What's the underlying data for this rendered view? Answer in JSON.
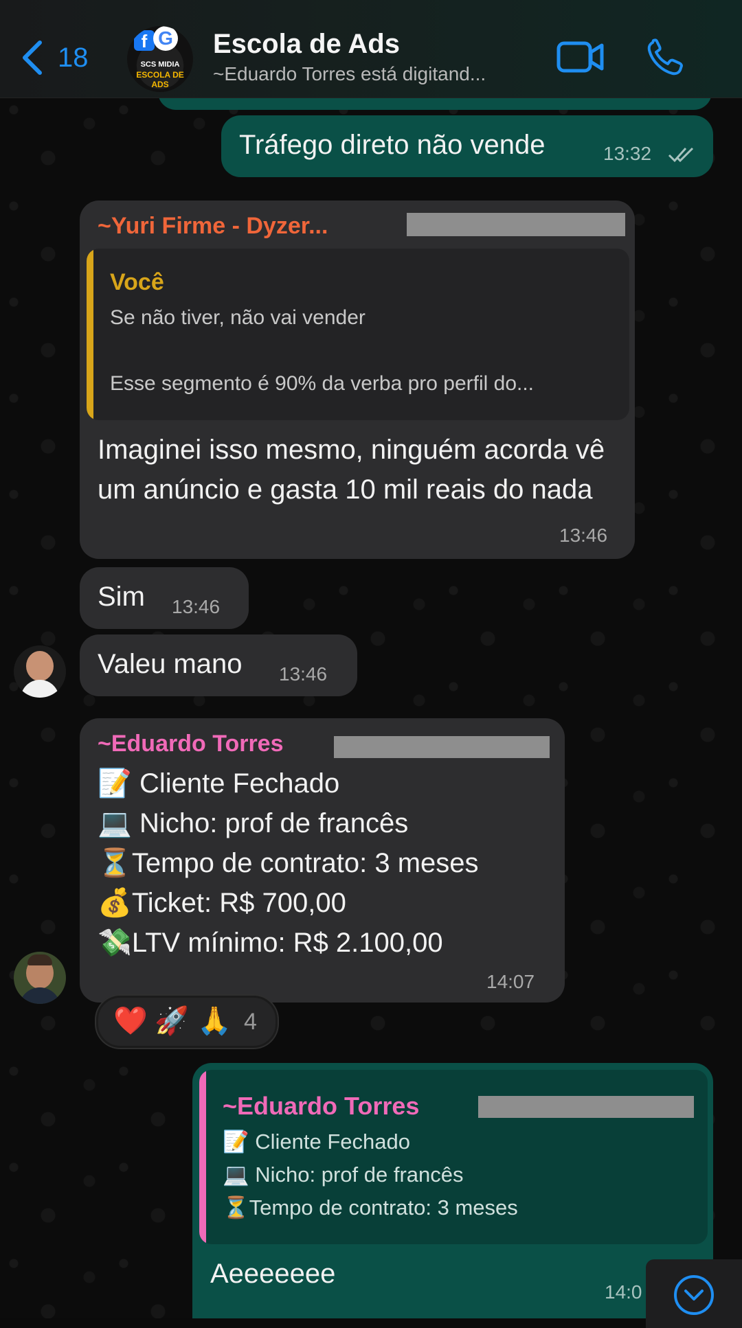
{
  "header": {
    "back_count": "18",
    "title": "Escola de Ads",
    "subtitle": "~Eduardo Torres está digitand...",
    "avatar_brand_line1": "SCS MIDIA",
    "avatar_brand_line2": "ESCOLA DE ADS",
    "icons": [
      "back-chevron-icon",
      "video-call-icon",
      "phone-call-icon"
    ]
  },
  "messages": {
    "m1": {
      "text": "Tráfego direto não vende",
      "time": "13:32"
    },
    "m2": {
      "sender": "~Yuri Firme - Dyzer...",
      "quote_author": "Você",
      "quote_line1": "Se não tiver, não vai vender",
      "quote_line2": "Esse segmento é 90% da verba pro perfil do...",
      "text": "Imaginei isso mesmo, ninguém acorda vê um anúncio e gasta 10 mil reais do nada",
      "time": "13:46"
    },
    "m3": {
      "text": "Sim",
      "time": "13:46"
    },
    "m4": {
      "text": "Valeu mano",
      "time": "13:46"
    },
    "m5": {
      "sender": "~Eduardo Torres",
      "line1_emoji": "📝",
      "line1": "Cliente Fechado",
      "line2_emoji": "💻",
      "line2": "Nicho: prof de francês",
      "line3_emoji": "⏳",
      "line3": "Tempo de contrato: 3 meses",
      "line4_emoji": "💰",
      "line4": "Ticket: R$ 700,00",
      "line5_emoji": "💸",
      "line5": "LTV mínimo: R$ 2.100,00",
      "time": "14:07",
      "reactions": {
        "r1": "❤️",
        "r2": "🚀",
        "r3": "🙏",
        "count": "4"
      }
    },
    "m6": {
      "quote_author": "~Eduardo Torres",
      "quote_line1_emoji": "📝",
      "quote_line1": "Cliente Fechado",
      "quote_line2_emoji": "💻",
      "quote_line2": "Nicho: prof de francês",
      "quote_line3_emoji": "⏳",
      "quote_line3": "Tempo de contrato: 3 meses",
      "text": "Aeeeeeee",
      "time": "14:0"
    }
  },
  "colors": {
    "accent_blue": "#1f8ef1",
    "incoming_bubble": "#2d2d2f",
    "outgoing_bubble": "#0a5047",
    "yuri_name": "#f0663a",
    "voce_name": "#d8a51a",
    "eduardo_name": "#f06ab8"
  }
}
